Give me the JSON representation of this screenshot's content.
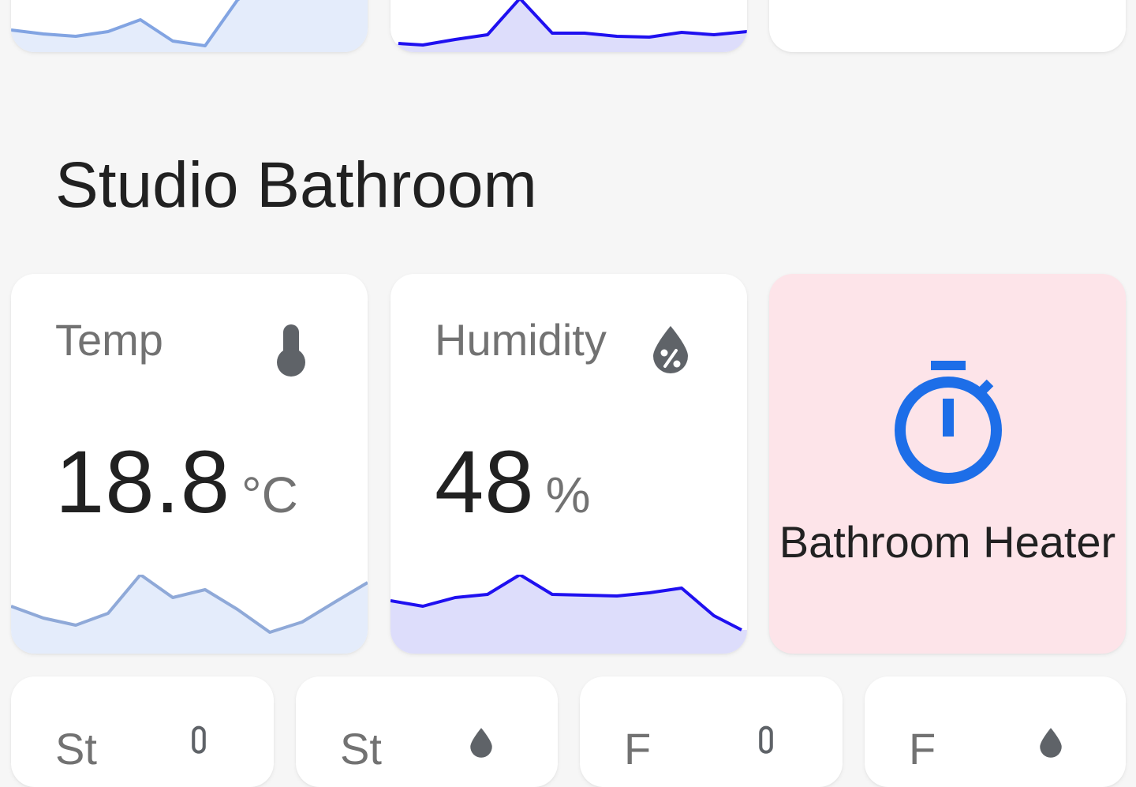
{
  "section": {
    "title": "Studio Bathroom"
  },
  "prev_row": {
    "cards": [
      {
        "kind": "sensor-graph",
        "accent": "#82a4e2",
        "fill": "#e4ecfb"
      },
      {
        "kind": "sensor-graph",
        "accent": "#1f10f0",
        "fill": "#ddddfb"
      },
      {
        "kind": "blank"
      }
    ]
  },
  "temp_card": {
    "name": "Temp",
    "icon": "thermometer-icon",
    "value": "18.8",
    "unit": "°C",
    "accent": "#82a4e2",
    "fill": "#e4ecfb"
  },
  "humidity_card": {
    "name": "Humidity",
    "icon": "water-percent-icon",
    "value": "48",
    "unit": "%",
    "accent": "#1f10f0",
    "fill": "#ddddfb"
  },
  "heater_card": {
    "name": "Bathroom Heater",
    "icon": "timer-icon",
    "state_color": "#fde4e9",
    "icon_color": "#1d6ee8"
  },
  "next_row": {
    "cards": [
      {
        "name": "St",
        "icon": "thermometer-icon"
      },
      {
        "name": "St",
        "icon": "water-percent-icon"
      },
      {
        "name": "F",
        "icon": "thermometer-icon"
      },
      {
        "name": "F",
        "icon": "water-percent-icon"
      }
    ]
  },
  "colors": {
    "background": "#f6f6f6",
    "card": "#ffffff",
    "primary_text": "#212121",
    "secondary_text": "#727272",
    "icon_gray": "#5f6368"
  }
}
